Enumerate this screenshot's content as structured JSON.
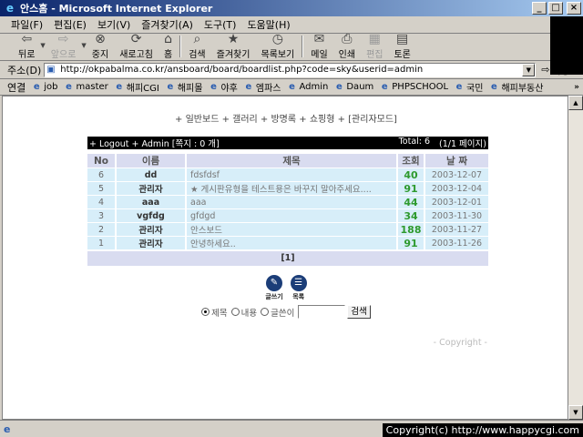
{
  "window": {
    "title": "안스홈 - Microsoft Internet Explorer",
    "buttons": [
      "_",
      "□",
      "×"
    ]
  },
  "menu": [
    "파일(F)",
    "편집(E)",
    "보기(V)",
    "즐겨찾기(A)",
    "도구(T)",
    "도움말(H)"
  ],
  "toolbar": {
    "back": "뒤로",
    "forward": "앞으로",
    "stop": "중지",
    "refresh": "새로고침",
    "home": "홈",
    "search": "검색",
    "favorites": "즐겨찾기",
    "history": "목록보기",
    "mail": "메일",
    "print": "인쇄",
    "edit": "편집",
    "discuss": "토론"
  },
  "address": {
    "label": "주소(D)",
    "url": "http://okpabalma.co.kr/ansboard/board/boardlist.php?code=sky&userid=admin",
    "go": "이동"
  },
  "links": {
    "label": "연결",
    "items": [
      "job",
      "master",
      "해피CGI",
      "해피몰",
      "야후",
      "엠파스",
      "Admin",
      "Daum",
      "PHPSCHOOL",
      "국민",
      "해피부동산"
    ]
  },
  "board_nav": "+ 일반보드 + 갤러리 + 방명록 + 쇼핑형 + [관리자모드]",
  "board": {
    "head_left": "+ Logout + Admin [쪽지 : 0 개]",
    "total": "Total: 6",
    "pages": "(1/1 페이지)",
    "columns": [
      "No",
      "이름",
      "제목",
      "조회",
      "날 짜"
    ],
    "rows": [
      {
        "no": "6",
        "author": "dd",
        "subject": "fdsfdsf",
        "views": "40",
        "date": "2003-12-07"
      },
      {
        "no": "5",
        "author": "관리자",
        "subject": "★ 게시판유형을 테스트용은 바꾸지 말아주세요....",
        "views": "91",
        "date": "2003-12-04"
      },
      {
        "no": "4",
        "author": "aaa",
        "subject": "aaa",
        "views": "44",
        "date": "2003-12-01"
      },
      {
        "no": "3",
        "author": "vgfdg",
        "subject": "gfdgd",
        "views": "34",
        "date": "2003-11-30"
      },
      {
        "no": "2",
        "author": "관리자",
        "subject": "안스보드",
        "views": "188",
        "date": "2003-11-27"
      },
      {
        "no": "1",
        "author": "관리자",
        "subject": "안녕하세요..",
        "views": "91",
        "date": "2003-11-26"
      }
    ],
    "pager": "[1]",
    "write_label": "글쓰기",
    "list_label": "목록"
  },
  "search": {
    "options": [
      "제목",
      "내용",
      "글쓴이"
    ],
    "selected": 0,
    "button": "검색"
  },
  "copyright_inner": "- Copyright -",
  "status_copyright": "Copyright(c) http://www.happycgi.com"
}
